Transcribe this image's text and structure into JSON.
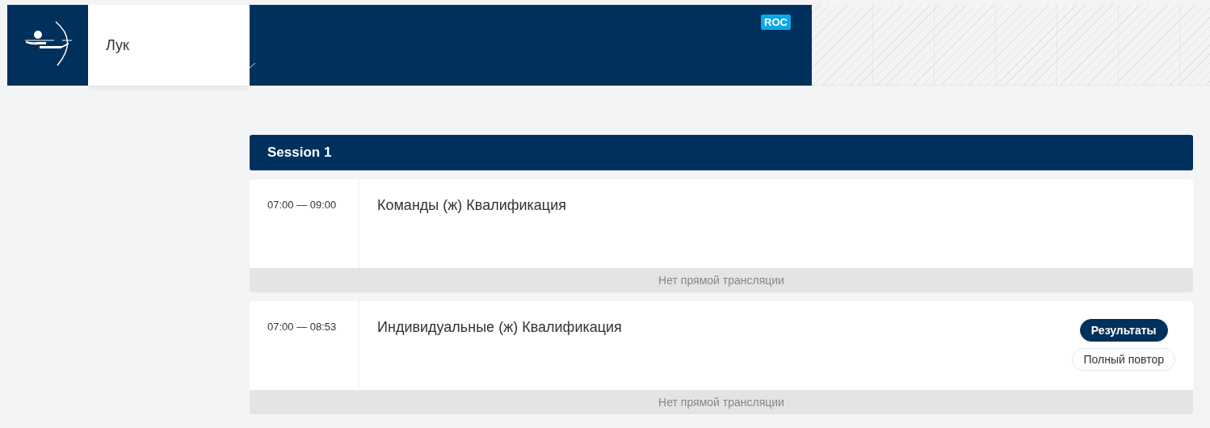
{
  "header": {
    "sport": "Лук",
    "badge": "ROC"
  },
  "session": {
    "title": "Session 1"
  },
  "events": [
    {
      "time": "07:00 — 09:00",
      "title": "Команды (ж) Квалификация",
      "broadcast": "Нет прямой трансляции"
    },
    {
      "time": "07:00 — 08:53",
      "title": "Индивидуальные (ж) Квалификация",
      "buttons": [
        {
          "label": "Результаты",
          "kind": "primary"
        },
        {
          "label": "Полный повтор",
          "kind": "outline"
        }
      ],
      "broadcast": "Нет прямой трансляции"
    }
  ]
}
